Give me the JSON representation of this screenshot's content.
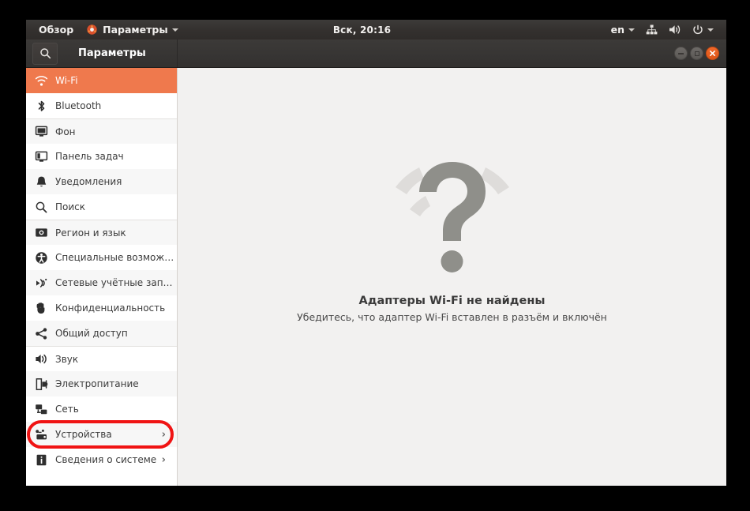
{
  "top_panel": {
    "overview_label": "Обзор",
    "app_icon": "settings-app-icon",
    "app_menu_label": "Параметры",
    "clock": "Вск, 20:16",
    "keyboard_layout": "en",
    "indicators": [
      {
        "name": "network-icon"
      },
      {
        "name": "volume-icon"
      },
      {
        "name": "power-icon"
      }
    ]
  },
  "window": {
    "title": "Параметры",
    "search_icon": "search-icon",
    "controls": {
      "minimize": "minimize-button",
      "maximize": "maximize-button",
      "close": "close-button"
    }
  },
  "sidebar": {
    "items": [
      {
        "label": "Wi-Fi",
        "icon": "wifi-icon",
        "active": true,
        "chevron": ""
      },
      {
        "label": "Bluetooth",
        "icon": "bluetooth-icon",
        "active": false,
        "chevron": ""
      },
      {
        "label": "Фон",
        "icon": "background-icon",
        "active": false,
        "chevron": ""
      },
      {
        "label": "Панель задач",
        "icon": "dock-icon",
        "active": false,
        "chevron": ""
      },
      {
        "label": "Уведомления",
        "icon": "bell-icon",
        "active": false,
        "chevron": ""
      },
      {
        "label": "Поиск",
        "icon": "search-icon",
        "active": false,
        "chevron": ""
      },
      {
        "label": "Регион и язык",
        "icon": "region-icon",
        "active": false,
        "chevron": ""
      },
      {
        "label": "Специальные возможности",
        "icon": "accessibility-icon",
        "active": false,
        "chevron": ""
      },
      {
        "label": "Сетевые учётные записи",
        "icon": "online-accounts-icon",
        "active": false,
        "chevron": ""
      },
      {
        "label": "Конфиденциальность",
        "icon": "privacy-hand-icon",
        "active": false,
        "chevron": ""
      },
      {
        "label": "Общий доступ",
        "icon": "share-icon",
        "active": false,
        "chevron": ""
      },
      {
        "label": "Звук",
        "icon": "sound-icon",
        "active": false,
        "chevron": ""
      },
      {
        "label": "Электропитание",
        "icon": "power-plug-icon",
        "active": false,
        "chevron": ""
      },
      {
        "label": "Сеть",
        "icon": "network-icon",
        "active": false,
        "chevron": ""
      },
      {
        "label": "Устройства",
        "icon": "devices-icon",
        "active": false,
        "chevron": "›",
        "highlighted": true
      },
      {
        "label": "Сведения о системе",
        "icon": "info-icon",
        "active": false,
        "chevron": "›"
      }
    ]
  },
  "main": {
    "placeholder_icon": "wifi-question-mark-icon",
    "empty_title": "Адаптеры Wi-Fi не найдены",
    "empty_subtitle": "Убедитесь, что адаптер Wi-Fi вставлен в разъём и включён"
  },
  "colors": {
    "accent": "#ef794d",
    "panel": "#34312f",
    "content_bg": "#f2f1f0",
    "highlight_annotation": "#f01414",
    "close_button": "#e85d18"
  }
}
